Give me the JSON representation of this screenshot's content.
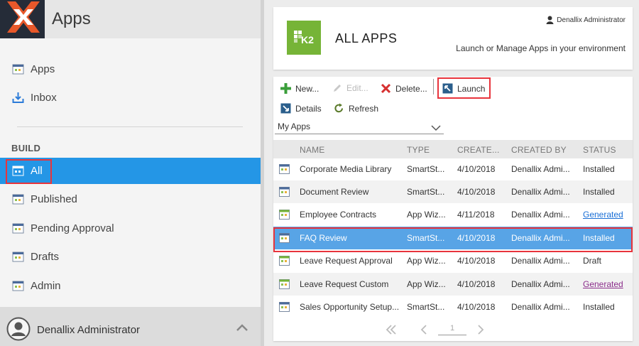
{
  "sidebar": {
    "app_title": "Apps",
    "top_items": [
      {
        "label": "Apps",
        "icon": "app-icon"
      },
      {
        "label": "Inbox",
        "icon": "inbox-icon"
      }
    ],
    "build_section_label": "BUILD",
    "build_items": [
      {
        "label": "All",
        "icon": "app-icon",
        "selected": true
      },
      {
        "label": "Published",
        "icon": "app-icon"
      },
      {
        "label": "Pending Approval",
        "icon": "app-icon"
      },
      {
        "label": "Drafts",
        "icon": "app-icon"
      },
      {
        "label": "Admin",
        "icon": "app-icon"
      }
    ],
    "user_name": "Denallix Administrator"
  },
  "header": {
    "logo_text": "K2",
    "title": "ALL APPS",
    "user": "Denallix Administrator",
    "subtitle": "Launch or Manage Apps in your environment"
  },
  "toolbar": {
    "new_label": "New...",
    "edit_label": "Edit...",
    "delete_label": "Delete...",
    "launch_label": "Launch",
    "details_label": "Details",
    "refresh_label": "Refresh"
  },
  "filter": {
    "selected": "My Apps"
  },
  "table": {
    "columns": [
      "NAME",
      "TYPE",
      "CREATE...",
      "CREATED BY",
      "STATUS"
    ],
    "rows": [
      {
        "name": "Corporate Media Library",
        "type": "SmartSt...",
        "created": "4/10/2018",
        "created_by": "Denallix Admi...",
        "status": "Installed"
      },
      {
        "name": "Document Review",
        "type": "SmartSt...",
        "created": "4/10/2018",
        "created_by": "Denallix Admi...",
        "status": "Installed"
      },
      {
        "name": "Employee Contracts",
        "type": "App Wiz...",
        "created": "4/11/2018",
        "created_by": "Denallix Admi...",
        "status": "Generated"
      },
      {
        "name": "FAQ Review",
        "type": "SmartSt...",
        "created": "4/10/2018",
        "created_by": "Denallix Admi...",
        "status": "Installed"
      },
      {
        "name": "Leave Request Approval",
        "type": "App Wiz...",
        "created": "4/10/2018",
        "created_by": "Denallix Admi...",
        "status": "Draft"
      },
      {
        "name": "Leave Request Custom",
        "type": "App Wiz...",
        "created": "4/10/2018",
        "created_by": "Denallix Admi...",
        "status": "Generated"
      },
      {
        "name": "Sales Opportunity Setup...",
        "type": "SmartSt...",
        "created": "4/10/2018",
        "created_by": "Denallix Admi...",
        "status": "Installed"
      }
    ]
  },
  "pager": {
    "page": "1"
  },
  "colors": {
    "accent": "#2496e6",
    "selected_row": "#58a4e6",
    "highlight_border": "#e8343c",
    "k2_green": "#76b437",
    "logo_orange": "#e8582a",
    "link": "#1a6fd6"
  }
}
